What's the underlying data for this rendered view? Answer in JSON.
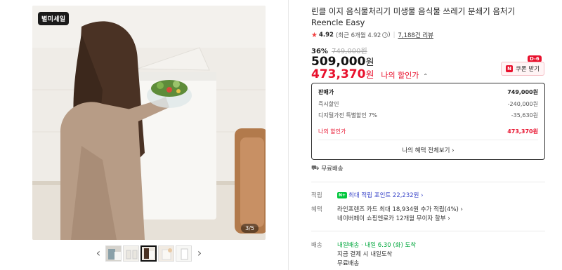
{
  "gallery": {
    "brand_badge": "별미세일",
    "counter": "3/5",
    "prev_arrow": "‹",
    "next_arrow": "›",
    "thumbnail_count": 5,
    "active_thumbnail": 3
  },
  "product": {
    "title": "린클 이지 음식물처리기 미생물 음식물 쓰레기 분쇄기 음처기 Reencle Easy",
    "rating": "4.92",
    "rating_recent": "(최근 6개월 4.92",
    "rating_recent_close": ")",
    "review_count": "7,188건 리뷰",
    "discount_rate": "36%",
    "original_price": "749,000원",
    "sale_price": "509,000",
    "won": "원",
    "my_price": "473,370",
    "my_price_label": "나의 할인가",
    "coupon_label": "쿠폰 받기",
    "dday_badge": "D-6"
  },
  "price_box": {
    "rows": [
      {
        "label": "판매가",
        "value": "749,000원"
      },
      {
        "label": "즉시할인",
        "value": "-240,000원"
      },
      {
        "label": "디지털가전 특별할인 7%",
        "value": "-35,630원"
      }
    ],
    "my_label": "나의 할인가",
    "my_value": "473,370원",
    "benefit_link": "나의 혜택 전체보기 ›"
  },
  "shipping_free": "무료배송",
  "earn": {
    "label": "적립",
    "badge": "N+",
    "text": "최대 적립 포인트 22,232원 ›"
  },
  "benefit": {
    "label": "혜택",
    "line1": "라인프렌즈 카드 최대 18,934원 추가 적립(4%) ›",
    "line2": "네이버페이 쇼핑엔로카 12개월 무이자 할부 ›"
  },
  "delivery": {
    "label": "배송",
    "line1_badge": "내일배송",
    "line1_text": "· 내일 6.30 (화) 도착",
    "line2": "지금 결제 시 내일도착",
    "line3": "무료배송"
  },
  "colors": {
    "accent_red": "#e8112d",
    "naver_green": "#00c73c"
  }
}
